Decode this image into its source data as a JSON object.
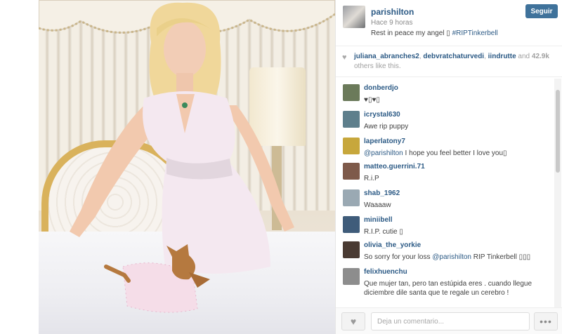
{
  "post": {
    "owner": "parishilton",
    "time": "Hace 9 horas",
    "caption_text": "Rest in peace my angel ▯ ",
    "caption_tag": "#RIPTinkerbell",
    "follow_label": "Seguir"
  },
  "likes": {
    "likers": [
      "juliana_abranches2",
      "debvratchaturvedi",
      "iindrutte"
    ],
    "separator": ", ",
    "and": " and",
    "count": "42.9k",
    "rest": " others like this."
  },
  "comments": [
    {
      "user": "donberdjo",
      "text": "♥▯♥▯",
      "avatar_color": "#6b7a5a"
    },
    {
      "user": "icrystal630",
      "text": "Awe rip puppy",
      "avatar_color": "#5e7f8c"
    },
    {
      "user": "laperlatony7",
      "mention": "@parishilton",
      "text": " I hope you feel better I love you▯",
      "avatar_color": "#c7a73c"
    },
    {
      "user": "matteo.guerrini.71",
      "text": "R.i.P",
      "avatar_color": "#7e5a4a"
    },
    {
      "user": "shab_1962",
      "text": "Waaaaw",
      "avatar_color": "#9aa9b3"
    },
    {
      "user": "miniibell",
      "text": "R.I.P. cutie ▯",
      "avatar_color": "#3f5c7a"
    },
    {
      "user": "olivia_the_yorkie",
      "text_before": "So sorry for your loss ",
      "mention": "@parishilton",
      "text": " RIP Tinkerbell ▯▯▯",
      "avatar_color": "#4a3b33"
    },
    {
      "user": "felixhuenchu",
      "text": "Que mujer tan, pero tan estúpida eres . cuando llegue diciembre dile santa que te regale un cerebro !",
      "avatar_color": "#8d8d8d"
    }
  ],
  "footer": {
    "comment_placeholder": "Deja un comentario...",
    "like_icon": "heart-icon",
    "more_icon": "ellipsis-icon",
    "more_label": "•••"
  },
  "colors": {
    "accent": "#3f729b",
    "link": "#2c5a85"
  }
}
